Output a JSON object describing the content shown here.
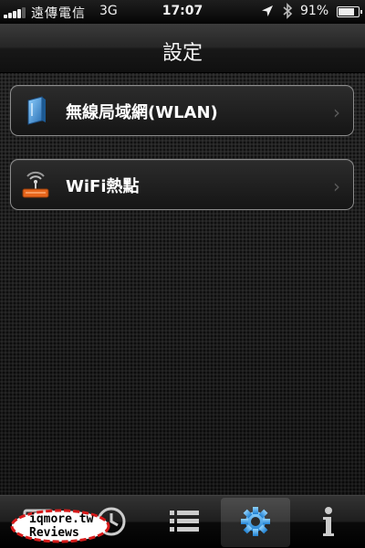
{
  "status_bar": {
    "carrier": "遠傳電信",
    "network": "3G",
    "time": "17:07",
    "battery": "91%",
    "battery_level": 0.91,
    "icons": [
      "signal-icon",
      "location-arrow-icon",
      "bluetooth-icon",
      "battery-icon"
    ]
  },
  "navbar": {
    "title": "設定"
  },
  "menu": {
    "items": [
      {
        "label": "無線局域網(WLAN)",
        "icon": "wlan-router-icon"
      },
      {
        "label": "WiFi熱點",
        "icon": "wifi-hotspot-icon"
      }
    ]
  },
  "tab_bar": {
    "tabs": [
      {
        "icon": "screen-icon",
        "selected": false
      },
      {
        "icon": "clock-icon",
        "selected": false
      },
      {
        "icon": "list-icon",
        "selected": false
      },
      {
        "icon": "settings-gear-icon",
        "selected": true
      },
      {
        "icon": "info-icon",
        "selected": false
      }
    ]
  },
  "watermark": {
    "line1": "iqmore.tw",
    "line2": "Reviews"
  },
  "colors": {
    "accent_blue": "#3aa0e8",
    "hotspot_orange": "#e8661c",
    "watermark_circle": "#d71a1a"
  }
}
